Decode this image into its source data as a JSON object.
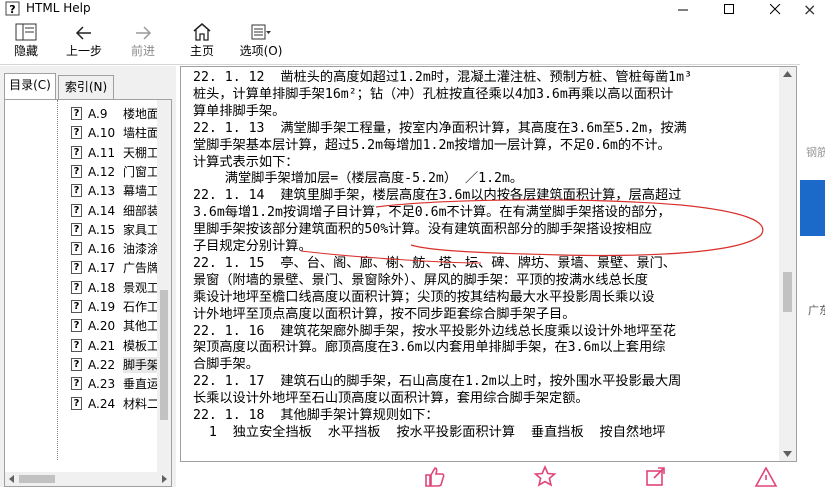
{
  "window": {
    "title": "HTML Help"
  },
  "toolbar": {
    "hide_label": "隐藏",
    "back_label": "上一步",
    "forward_label": "前进",
    "home_label": "主页",
    "options_label": "选项(O)"
  },
  "tabs": {
    "contents_label": "目录(C)",
    "index_label": "索引(N)"
  },
  "tree": {
    "items": [
      {
        "num": "A.9",
        "name": "楼地面"
      },
      {
        "num": "A.10",
        "name": "墙柱面"
      },
      {
        "num": "A.11",
        "name": "天棚工"
      },
      {
        "num": "A.12",
        "name": "门窗工"
      },
      {
        "num": "A.13",
        "name": "幕墙工"
      },
      {
        "num": "A.14",
        "name": "细部装"
      },
      {
        "num": "A.15",
        "name": "家具工"
      },
      {
        "num": "A.16",
        "name": "油漆涂"
      },
      {
        "num": "A.17",
        "name": "广告牌"
      },
      {
        "num": "A.18",
        "name": "景观工"
      },
      {
        "num": "A.19",
        "name": "石作工"
      },
      {
        "num": "A.20",
        "name": "其他工"
      },
      {
        "num": "A.21",
        "name": "模板工"
      },
      {
        "num": "A.22",
        "name": "脚手架"
      },
      {
        "num": "A.23",
        "name": "垂直运"
      },
      {
        "num": "A.24",
        "name": "材料二"
      }
    ]
  },
  "content": {
    "lines": [
      "22. 1. 12  凿桩头的高度如超过1.2m时，混凝土灌注桩、预制方桩、管桩每凿1m³",
      "桩头，计算单排脚手架16m²；钻（冲）孔桩按直径乘以4加3.6m再乘以高以面积计",
      "算单排脚手架。",
      "22. 1. 13  满堂脚手架工程量，按室内净面积计算，其高度在3.6m至5.2m，按满",
      "堂脚手架基本层计算，超过5.2m每增加1.2m按增加一层计算，不足0.6m的不计。",
      "计算式表示如下：",
      "    满堂脚手架增加层=（楼层高度-5.2m） ／1.2m。",
      "22. 1. 14  建筑里脚手架，楼层高度在3.6m以内按各层建筑面积计算，层高超过",
      "3.6m每增1.2m按调增子目计算，不足0.6m不计算。在有满堂脚手架搭设的部分，",
      "里脚手架按该部分建筑面积的50%计算。没有建筑面积部分的脚手架搭设按相应",
      "子目规定分别计算。",
      "22. 1. 15  亭、台、阁、廊、榭、舫、塔、坛、碑、牌坊、景墙、景壁、景门、",
      "景窗（附墙的景壁、景门、景窗除外）、屏风的脚手架：平顶的按满水线总长度",
      "乘设计地坪至檐口线高度以面积计算；尖顶的按其结构最大水平投影周长乘以设",
      "计外地坪至顶点高度以面积计算，按不同步距套综合脚手架子目。",
      "22. 1. 16  建筑花架廊外脚手架，按水平投影外边线总长度乘以设计外地坪至花",
      "架顶高度以面积计算。廊顶高度在3.6m以内套用单排脚手架，在3.6m以上套用综",
      "合脚手架。",
      "22. 1. 17  建筑石山的脚手架，石山高度在1.2m以上时，按外围水平投影最大周",
      "长乘以设计外地坪至石山顶高度以面积计算，套用综合脚手架定额。",
      "22. 1. 18  其他脚手架计算规则如下：",
      "  1  独立安全挡板  水平挡板  按水平投影面积计算  垂直挡板  按自然地坪"
    ]
  },
  "background_window": {
    "text_top": "钢筋",
    "text_mid": "广东"
  },
  "colors": {
    "accent_blue": "#1b6ac9",
    "annotation_red": "#d9302c",
    "bottom_pink": "#e0457b"
  }
}
